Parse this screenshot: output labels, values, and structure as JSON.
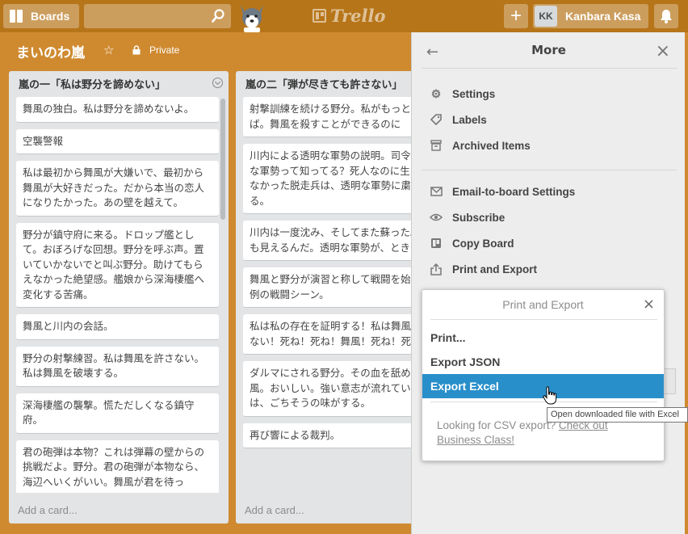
{
  "header": {
    "boards_label": "Boards",
    "logo_text": "Trello",
    "add_label": "+",
    "user": {
      "initials": "KK",
      "name": "Kanbara Kasa"
    }
  },
  "board": {
    "title": "まいのわ嵐",
    "visibility": "Private"
  },
  "lists": [
    {
      "title": "嵐の一「私は野分を諦めない」",
      "cards": [
        "舞風の独白。私は野分を諦めないよ。",
        "空襲警報",
        "私は最初から舞風が大嫌いで、最初から舞風が大好きだった。だから本当の恋人になりたかった。あの壁を越えて。",
        "野分が鎮守府に来る。ドロップ艦として。おぼろげな回想。野分を呼ぶ声。置いていかないでと叫ぶ野分。助けてもらえなかった絶望感。艦娘から深海棲艦へ変化する苦痛。",
        "舞風と川内の会話。",
        "野分の射撃練習。私は舞風を許さない。私は舞風を破壊する。",
        "深海棲艦の襲撃。慌ただしくなる鎮守府。",
        "君の砲弾は本物？これは弾幕の壁からの挑戦だよ。野分。君の砲弾が本物なら、海辺へいくがいい。舞風が君を待っ"
      ],
      "add_card": "Add a card..."
    },
    {
      "title": "嵐の二「弾が尽きても許さない」",
      "cards": [
        "射撃訓練を続ける野分。私がもっと強ければ。舞風を殺すことができるのに",
        "川内による透明な軍勢の説明。司令は透明な軍勢って知ってる？死人なのに生を諦めなかった脱走兵は、透明な軍勢に粛正される。",
        "川内は一度沈み、そしてまた蘇った。私にも見えるんだ。透明な軍勢が、ときどう。",
        "舞風と野分が演習と称して戦闘を始める。例の戦闘シーン。",
        "私は私の存在を証明する！私は舞風を許さない！死ね！死ね！舞風！死ね！死ね！",
        "ダルマにされる野分。その血を舐める舞風。おいしい。強い意志が流れている血は、ごちそうの味がする。",
        "再び響による裁判。"
      ],
      "add_card": "Add a card..."
    }
  ],
  "sidebar": {
    "title": "More",
    "group1": [
      "Settings",
      "Labels",
      "Archived Items"
    ],
    "group2": [
      "Email-to-board Settings",
      "Subscribe",
      "Copy Board",
      "Print and Export"
    ]
  },
  "popover": {
    "title": "Print and Export",
    "items": [
      "Print...",
      "Export JSON",
      "Export Excel"
    ],
    "note_prefix": "Looking for CSV export? ",
    "note_link": "Check out Business Class!"
  },
  "tooltip": "Open downloaded file with Excel",
  "colors": {
    "board_bg": "#cf8a30",
    "header_bg": "#b77519",
    "highlight": "#298fca"
  }
}
